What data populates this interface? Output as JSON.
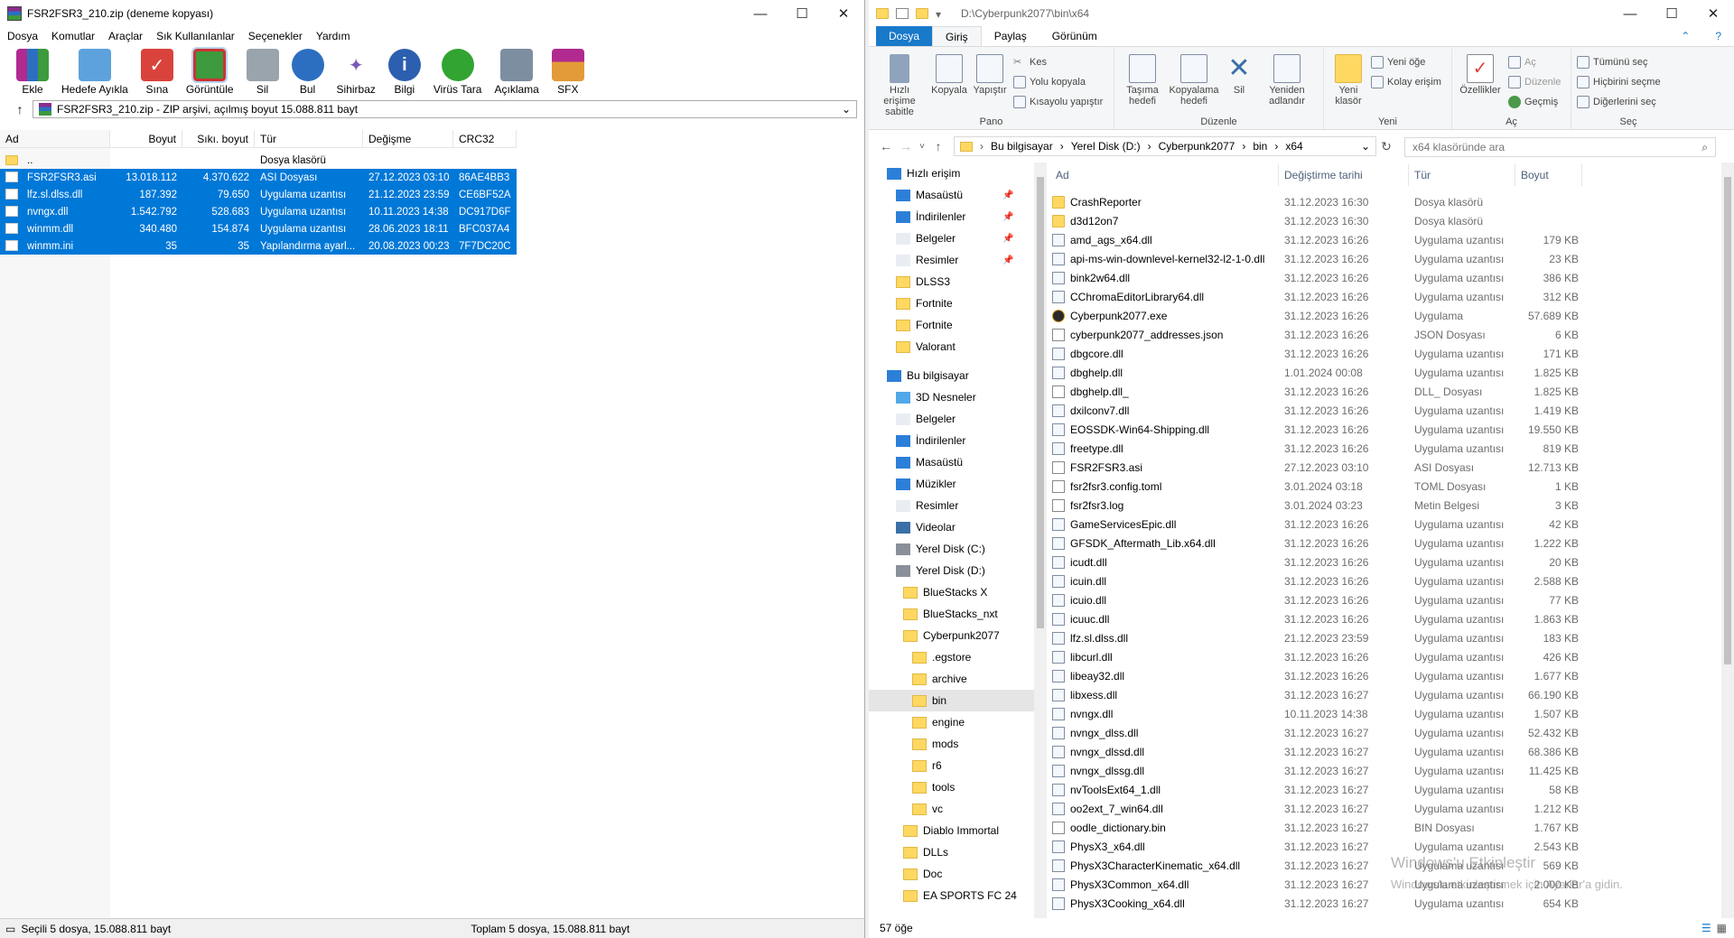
{
  "winrar": {
    "title": "FSR2FSR3_210.zip (deneme kopyası)",
    "window_controls": [
      "—",
      "☐",
      "✕"
    ],
    "menu": [
      "Dosya",
      "Komutlar",
      "Araçlar",
      "Sık Kullanılanlar",
      "Seçenekler",
      "Yardım"
    ],
    "toolbar": [
      "Ekle",
      "Hedefe Ayıkla",
      "Sına",
      "Görüntüle",
      "Sil",
      "Bul",
      "Sihirbaz",
      "Bilgi",
      "Virüs Tara",
      "Açıklama",
      "SFX"
    ],
    "address": "FSR2FSR3_210.zip - ZIP arşivi, açılmış boyut 15.088.811 bayt",
    "columns": [
      "Ad",
      "Boyut",
      "Sıkı. boyut",
      "Tür",
      "Değişme",
      "CRC32"
    ],
    "parent_row": {
      "name": "..",
      "type": "Dosya klasörü"
    },
    "files": [
      {
        "name": "FSR2FSR3.asi",
        "size": "13.018.112",
        "packed": "4.370.622",
        "type": "ASI Dosyası",
        "modified": "27.12.2023 03:10",
        "crc": "86AE4BB3"
      },
      {
        "name": "lfz.sl.dlss.dll",
        "size": "187.392",
        "packed": "79.650",
        "type": "Uygulama uzantısı",
        "modified": "21.12.2023 23:59",
        "crc": "CE6BF52A"
      },
      {
        "name": "nvngx.dll",
        "size": "1.542.792",
        "packed": "528.683",
        "type": "Uygulama uzantısı",
        "modified": "10.11.2023 14:38",
        "crc": "DC917D6F"
      },
      {
        "name": "winmm.dll",
        "size": "340.480",
        "packed": "154.874",
        "type": "Uygulama uzantısı",
        "modified": "28.06.2023 18:11",
        "crc": "BFC037A4"
      },
      {
        "name": "winmm.ini",
        "size": "35",
        "packed": "35",
        "type": "Yapılandırma ayarl...",
        "modified": "20.08.2023 00:23",
        "crc": "7F7DC20C"
      }
    ],
    "status_left": "Seçili 5 dosya, 15.088.811 bayt",
    "status_right": "Toplam 5 dosya, 15.088.811 bayt"
  },
  "explorer": {
    "title": "D:\\Cyberpunk2077\\bin\\x64",
    "window_controls": [
      "—",
      "☐",
      "✕"
    ],
    "ribbon_tabs": [
      "Dosya",
      "Giriş",
      "Paylaş",
      "Görünüm"
    ],
    "ribbon": {
      "pin": "Hızlı erişime sabitle",
      "copy": "Kopyala",
      "paste": "Yapıştır",
      "cut": "Kes",
      "copy_path": "Yolu kopyala",
      "paste_shortcut": "Kısayolu yapıştır",
      "move_to": "Taşıma hedefi",
      "copy_to": "Kopyalama hedefi",
      "delete": "Sil",
      "rename": "Yeniden adlandır",
      "new_folder": "Yeni klasör",
      "new_item": "Yeni öğe",
      "easy_access": "Kolay erişim",
      "properties": "Özellikler",
      "open": "Aç",
      "edit": "Düzenle",
      "history": "Geçmiş",
      "select_all": "Tümünü seç",
      "select_none": "Hiçbirini seçme",
      "invert": "Diğerlerini seç",
      "groups": [
        "Pano",
        "Düzenle",
        "Yeni",
        "Aç",
        "Seç"
      ]
    },
    "breadcrumb": [
      "Bu bilgisayar",
      "Yerel Disk (D:)",
      "Cyberpunk2077",
      "bin",
      "x64"
    ],
    "search_placeholder": "x64 klasöründe ara",
    "nav": [
      {
        "label": "Hızlı erişim",
        "icon": "star-icon",
        "level": 0,
        "pinned": false
      },
      {
        "label": "Masaüstü",
        "icon": "desktop-icon",
        "level": 1,
        "pinned": true
      },
      {
        "label": "İndirilenler",
        "icon": "download-icon",
        "level": 1,
        "pinned": true
      },
      {
        "label": "Belgeler",
        "icon": "documents-icon",
        "level": 1,
        "pinned": true
      },
      {
        "label": "Resimler",
        "icon": "pictures-icon",
        "level": 1,
        "pinned": true
      },
      {
        "label": "DLSS3",
        "icon": "folder-icon",
        "level": 1,
        "pinned": false
      },
      {
        "label": "Fortnite",
        "icon": "folder-icon",
        "level": 1,
        "pinned": false
      },
      {
        "label": "Fortnite",
        "icon": "folder-icon",
        "level": 1,
        "pinned": false
      },
      {
        "label": "Valorant",
        "icon": "folder-icon",
        "level": 1,
        "pinned": false
      },
      {
        "label": "Bu bilgisayar",
        "icon": "computer-icon",
        "level": 0,
        "pinned": false
      },
      {
        "label": "3D Nesneler",
        "icon": "3d-objects-icon",
        "level": 1,
        "pinned": false
      },
      {
        "label": "Belgeler",
        "icon": "documents-icon",
        "level": 1,
        "pinned": false
      },
      {
        "label": "İndirilenler",
        "icon": "download-icon",
        "level": 1,
        "pinned": false
      },
      {
        "label": "Masaüstü",
        "icon": "desktop-icon",
        "level": 1,
        "pinned": false
      },
      {
        "label": "Müzikler",
        "icon": "music-icon",
        "level": 1,
        "pinned": false
      },
      {
        "label": "Resimler",
        "icon": "pictures-icon",
        "level": 1,
        "pinned": false
      },
      {
        "label": "Videolar",
        "icon": "videos-icon",
        "level": 1,
        "pinned": false
      },
      {
        "label": "Yerel Disk (C:)",
        "icon": "drive-icon",
        "level": 1,
        "pinned": false
      },
      {
        "label": "Yerel Disk (D:)",
        "icon": "drive-icon",
        "level": 1,
        "pinned": false
      },
      {
        "label": "BlueStacks X",
        "icon": "folder-icon",
        "level": 2,
        "pinned": false
      },
      {
        "label": "BlueStacks_nxt",
        "icon": "folder-icon",
        "level": 2,
        "pinned": false
      },
      {
        "label": "Cyberpunk2077",
        "icon": "folder-icon",
        "level": 2,
        "pinned": false
      },
      {
        "label": ".egstore",
        "icon": "folder-icon",
        "level": 3,
        "pinned": false
      },
      {
        "label": "archive",
        "icon": "folder-icon",
        "level": 3,
        "pinned": false
      },
      {
        "label": "bin",
        "icon": "folder-icon",
        "level": 3,
        "pinned": false,
        "selected": true
      },
      {
        "label": "engine",
        "icon": "folder-icon",
        "level": 3,
        "pinned": false
      },
      {
        "label": "mods",
        "icon": "folder-icon",
        "level": 3,
        "pinned": false
      },
      {
        "label": "r6",
        "icon": "folder-icon",
        "level": 3,
        "pinned": false
      },
      {
        "label": "tools",
        "icon": "folder-icon",
        "level": 3,
        "pinned": false
      },
      {
        "label": "vc",
        "icon": "folder-icon",
        "level": 3,
        "pinned": false
      },
      {
        "label": "Diablo Immortal",
        "icon": "folder-icon",
        "level": 2,
        "pinned": false
      },
      {
        "label": "DLLs",
        "icon": "folder-icon",
        "level": 2,
        "pinned": false
      },
      {
        "label": "Doc",
        "icon": "folder-icon",
        "level": 2,
        "pinned": false
      },
      {
        "label": "EA SPORTS FC 24",
        "icon": "folder-icon",
        "level": 2,
        "pinned": false
      }
    ],
    "columns": [
      "Ad",
      "Değiştirme tarihi",
      "Tür",
      "Boyut"
    ],
    "files": [
      {
        "name": "CrashReporter",
        "date": "31.12.2023 16:30",
        "type": "Dosya klasörü",
        "size": "",
        "icon": "folder"
      },
      {
        "name": "d3d12on7",
        "date": "31.12.2023 16:30",
        "type": "Dosya klasörü",
        "size": "",
        "icon": "folder"
      },
      {
        "name": "amd_ags_x64.dll",
        "date": "31.12.2023 16:26",
        "type": "Uygulama uzantısı",
        "size": "179 KB",
        "icon": "dll"
      },
      {
        "name": "api-ms-win-downlevel-kernel32-l2-1-0.dll",
        "date": "31.12.2023 16:26",
        "type": "Uygulama uzantısı",
        "size": "23 KB",
        "icon": "dll"
      },
      {
        "name": "bink2w64.dll",
        "date": "31.12.2023 16:26",
        "type": "Uygulama uzantısı",
        "size": "386 KB",
        "icon": "dll"
      },
      {
        "name": "CChromaEditorLibrary64.dll",
        "date": "31.12.2023 16:26",
        "type": "Uygulama uzantısı",
        "size": "312 KB",
        "icon": "dll"
      },
      {
        "name": "Cyberpunk2077.exe",
        "date": "31.12.2023 16:26",
        "type": "Uygulama",
        "size": "57.689 KB",
        "icon": "exe"
      },
      {
        "name": "cyberpunk2077_addresses.json",
        "date": "31.12.2023 16:26",
        "type": "JSON Dosyası",
        "size": "6 KB",
        "icon": "file"
      },
      {
        "name": "dbgcore.dll",
        "date": "31.12.2023 16:26",
        "type": "Uygulama uzantısı",
        "size": "171 KB",
        "icon": "dll"
      },
      {
        "name": "dbghelp.dll",
        "date": "1.01.2024 00:08",
        "type": "Uygulama uzantısı",
        "size": "1.825 KB",
        "icon": "dll"
      },
      {
        "name": "dbghelp.dll_",
        "date": "31.12.2023 16:26",
        "type": "DLL_ Dosyası",
        "size": "1.825 KB",
        "icon": "file"
      },
      {
        "name": "dxilconv7.dll",
        "date": "31.12.2023 16:26",
        "type": "Uygulama uzantısı",
        "size": "1.419 KB",
        "icon": "dll"
      },
      {
        "name": "EOSSDK-Win64-Shipping.dll",
        "date": "31.12.2023 16:26",
        "type": "Uygulama uzantısı",
        "size": "19.550 KB",
        "icon": "dll"
      },
      {
        "name": "freetype.dll",
        "date": "31.12.2023 16:26",
        "type": "Uygulama uzantısı",
        "size": "819 KB",
        "icon": "dll"
      },
      {
        "name": "FSR2FSR3.asi",
        "date": "27.12.2023 03:10",
        "type": "ASI Dosyası",
        "size": "12.713 KB",
        "icon": "file"
      },
      {
        "name": "fsr2fsr3.config.toml",
        "date": "3.01.2024 03:18",
        "type": "TOML Dosyası",
        "size": "1 KB",
        "icon": "file"
      },
      {
        "name": "fsr2fsr3.log",
        "date": "3.01.2024 03:23",
        "type": "Metin Belgesi",
        "size": "3 KB",
        "icon": "file"
      },
      {
        "name": "GameServicesEpic.dll",
        "date": "31.12.2023 16:26",
        "type": "Uygulama uzantısı",
        "size": "42 KB",
        "icon": "dll"
      },
      {
        "name": "GFSDK_Aftermath_Lib.x64.dll",
        "date": "31.12.2023 16:26",
        "type": "Uygulama uzantısı",
        "size": "1.222 KB",
        "icon": "dll"
      },
      {
        "name": "icudt.dll",
        "date": "31.12.2023 16:26",
        "type": "Uygulama uzantısı",
        "size": "20 KB",
        "icon": "dll"
      },
      {
        "name": "icuin.dll",
        "date": "31.12.2023 16:26",
        "type": "Uygulama uzantısı",
        "size": "2.588 KB",
        "icon": "dll"
      },
      {
        "name": "icuio.dll",
        "date": "31.12.2023 16:26",
        "type": "Uygulama uzantısı",
        "size": "77 KB",
        "icon": "dll"
      },
      {
        "name": "icuuc.dll",
        "date": "31.12.2023 16:26",
        "type": "Uygulama uzantısı",
        "size": "1.863 KB",
        "icon": "dll"
      },
      {
        "name": "lfz.sl.dlss.dll",
        "date": "21.12.2023 23:59",
        "type": "Uygulama uzantısı",
        "size": "183 KB",
        "icon": "dll"
      },
      {
        "name": "libcurl.dll",
        "date": "31.12.2023 16:26",
        "type": "Uygulama uzantısı",
        "size": "426 KB",
        "icon": "dll"
      },
      {
        "name": "libeay32.dll",
        "date": "31.12.2023 16:26",
        "type": "Uygulama uzantısı",
        "size": "1.677 KB",
        "icon": "dll"
      },
      {
        "name": "libxess.dll",
        "date": "31.12.2023 16:27",
        "type": "Uygulama uzantısı",
        "size": "66.190 KB",
        "icon": "dll"
      },
      {
        "name": "nvngx.dll",
        "date": "10.11.2023 14:38",
        "type": "Uygulama uzantısı",
        "size": "1.507 KB",
        "icon": "dll"
      },
      {
        "name": "nvngx_dlss.dll",
        "date": "31.12.2023 16:27",
        "type": "Uygulama uzantısı",
        "size": "52.432 KB",
        "icon": "dll"
      },
      {
        "name": "nvngx_dlssd.dll",
        "date": "31.12.2023 16:27",
        "type": "Uygulama uzantısı",
        "size": "68.386 KB",
        "icon": "dll"
      },
      {
        "name": "nvngx_dlssg.dll",
        "date": "31.12.2023 16:27",
        "type": "Uygulama uzantısı",
        "size": "11.425 KB",
        "icon": "dll"
      },
      {
        "name": "nvToolsExt64_1.dll",
        "date": "31.12.2023 16:27",
        "type": "Uygulama uzantısı",
        "size": "58 KB",
        "icon": "dll"
      },
      {
        "name": "oo2ext_7_win64.dll",
        "date": "31.12.2023 16:27",
        "type": "Uygulama uzantısı",
        "size": "1.212 KB",
        "icon": "dll"
      },
      {
        "name": "oodle_dictionary.bin",
        "date": "31.12.2023 16:27",
        "type": "BIN Dosyası",
        "size": "1.767 KB",
        "icon": "file"
      },
      {
        "name": "PhysX3_x64.dll",
        "date": "31.12.2023 16:27",
        "type": "Uygulama uzantısı",
        "size": "2.543 KB",
        "icon": "dll"
      },
      {
        "name": "PhysX3CharacterKinematic_x64.dll",
        "date": "31.12.2023 16:27",
        "type": "Uygulama uzantısı",
        "size": "569 KB",
        "icon": "dll"
      },
      {
        "name": "PhysX3Common_x64.dll",
        "date": "31.12.2023 16:27",
        "type": "Uygulama uzantısı",
        "size": "2.000 KB",
        "icon": "dll"
      },
      {
        "name": "PhysX3Cooking_x64.dll",
        "date": "31.12.2023 16:27",
        "type": "Uygulama uzantısı",
        "size": "654 KB",
        "icon": "dll"
      }
    ],
    "status": "57 öğe",
    "watermark_title": "Windows'u Etkinleştir",
    "watermark_sub": "Windows'u etkinleştirmek için Ayarlar'a gidin."
  }
}
